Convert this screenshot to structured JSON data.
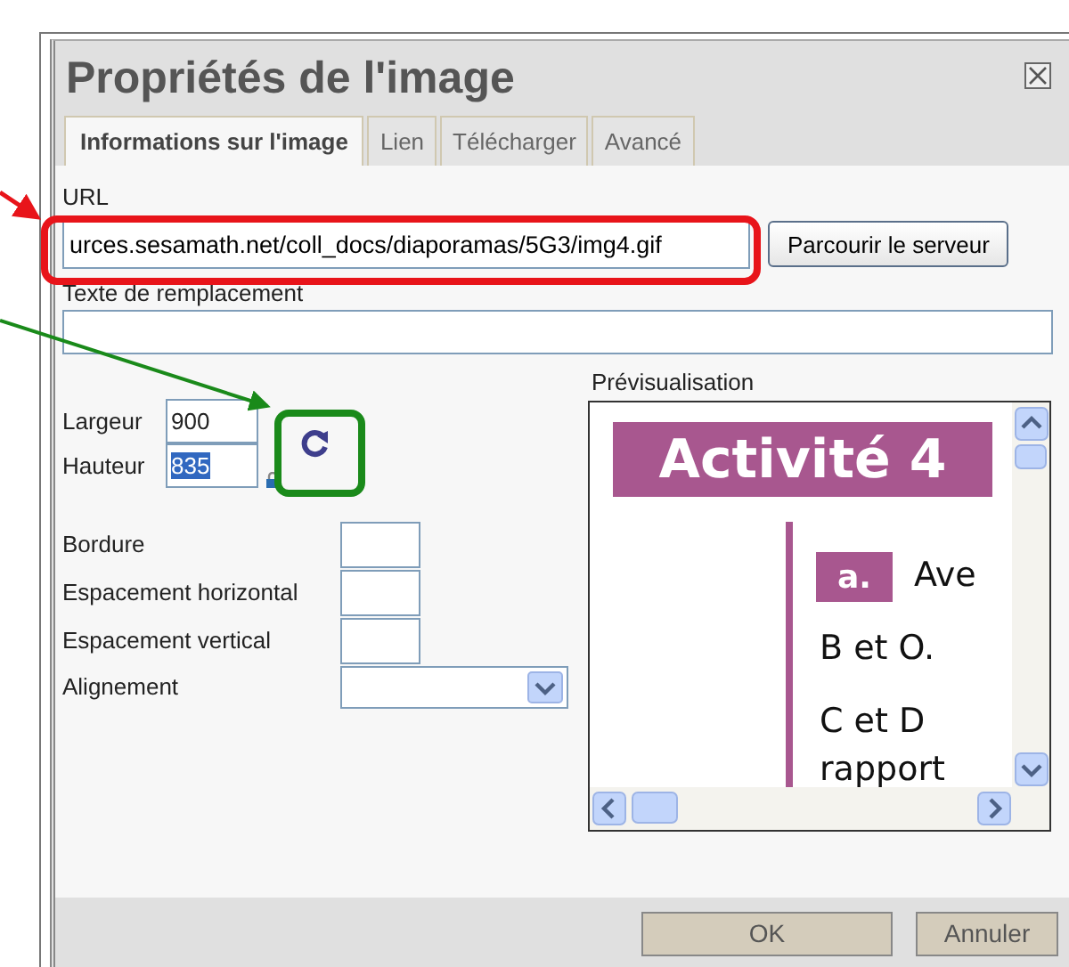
{
  "dialog": {
    "title": "Propriétés de l'image"
  },
  "tabs": [
    {
      "label": "Informations sur l'image",
      "selected": true
    },
    {
      "label": "Lien",
      "selected": false
    },
    {
      "label": "Télécharger",
      "selected": false
    },
    {
      "label": "Avancé",
      "selected": false
    }
  ],
  "url": {
    "label": "URL",
    "value": "urces.sesamath.net/coll_docs/diaporamas/5G3/img4.gif"
  },
  "browse_button": "Parcourir le serveur",
  "alt_text": {
    "label": "Texte de remplacement"
  },
  "size": [
    {
      "label": "Largeur",
      "value": "900",
      "text_selected": false
    },
    {
      "label": "Hauteur",
      "value": "835",
      "text_selected": true
    }
  ],
  "layout_fields": [
    {
      "kind": "text",
      "label": "Bordure"
    },
    {
      "kind": "text",
      "label": "Espacement horizontal"
    },
    {
      "kind": "text",
      "label": "Espacement vertical"
    },
    {
      "kind": "select",
      "label": "Alignement"
    }
  ],
  "preview": {
    "label": "Prévisualisation",
    "heading": "Activité 4",
    "badge": "a.",
    "lines": [
      "Ave",
      "B et O.",
      "C et D",
      "rapport"
    ]
  },
  "buttons": [
    "OK",
    "Annuler"
  ]
}
